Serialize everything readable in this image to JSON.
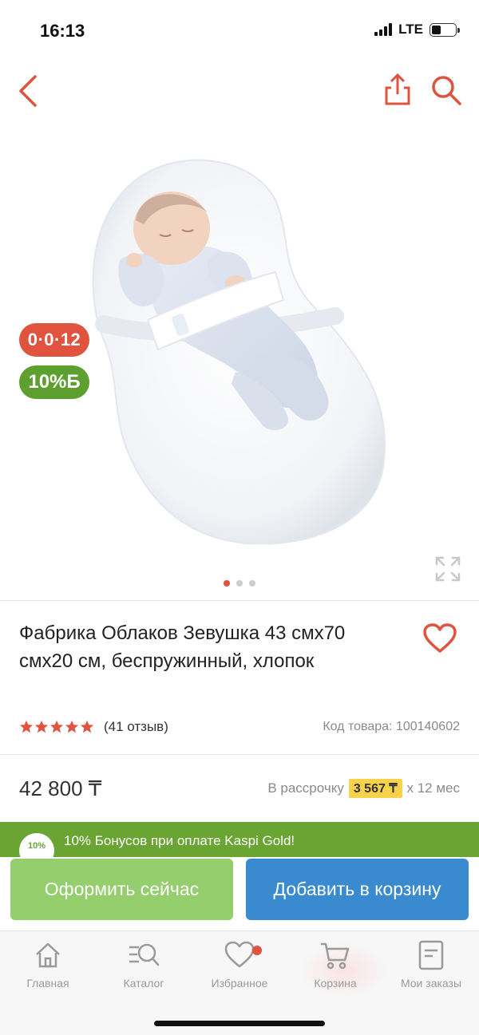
{
  "status_bar": {
    "time": "16:13",
    "network": "LTE"
  },
  "product": {
    "title": "Фабрика Облаков Зевушка 43 смх70 смх20 см, беспружинный, хлопок",
    "rating": 5,
    "reviews": "(41 отзыв)",
    "sku": "Код товара: 100140602",
    "price": "42 800 ₸",
    "installment_prefix": "В рассрочку",
    "installment_amount": "3 567 ₸",
    "installment_suffix": "х 12 мес"
  },
  "badges": {
    "installment": "0·0·12",
    "bonus": "10%Б"
  },
  "gallery": {
    "image_count": 3,
    "active_index": 0
  },
  "bonus_banner": {
    "circle": "10%",
    "text": "10% Бонусов при оплате Kaspi Gold!"
  },
  "actions": {
    "buy_now": "Оформить сейчас",
    "add_to_cart": "Добавить в корзину"
  },
  "tabs": [
    {
      "label": "Главная",
      "icon": "home-icon"
    },
    {
      "label": "Каталог",
      "icon": "catalog-icon"
    },
    {
      "label": "Избранное",
      "icon": "heart-icon"
    },
    {
      "label": "Корзина",
      "icon": "cart-icon"
    },
    {
      "label": "Мои заказы",
      "icon": "orders-icon"
    }
  ],
  "colors": {
    "accent_red": "#e0533f",
    "bonus_green": "#5ea02f",
    "buy_button": "#94ce6d",
    "cart_button": "#3a8ad0",
    "installment_highlight": "#f8d24b"
  }
}
